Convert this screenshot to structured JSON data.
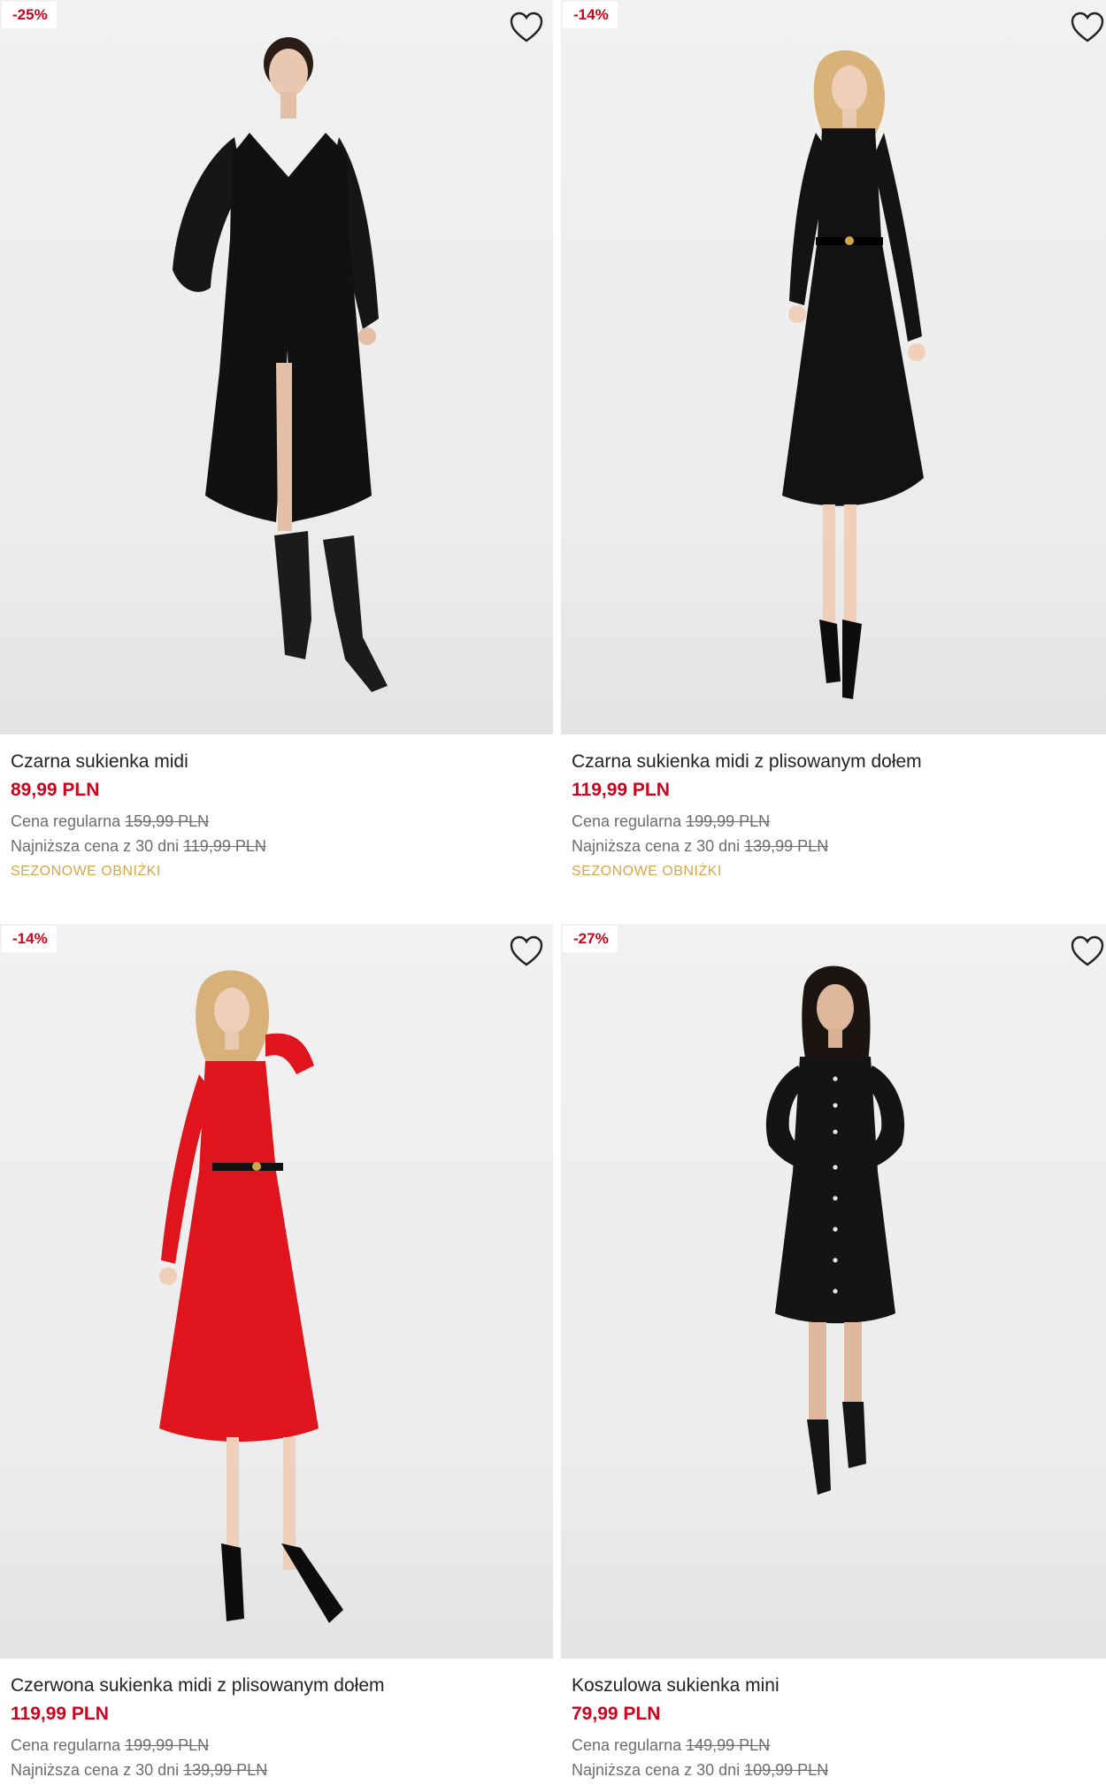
{
  "colors": {
    "accent_red": "#d0021b",
    "season_tag": "#d4a849",
    "muted": "#6d6d6d"
  },
  "products": [
    {
      "discount": "-25%",
      "name": "Czarna sukienka midi",
      "price": "89,99 PLN",
      "regular_label": "Cena regularna",
      "regular_price": "159,99 PLN",
      "lowest_label": "Najniższa cena z 30 dni",
      "lowest_price": "119,99 PLN",
      "tag": "SEZONOWE OBNIŻKI",
      "favorite_icon": "heart-icon",
      "dress_color": "#111111"
    },
    {
      "discount": "-14%",
      "name": "Czarna sukienka midi z plisowanym dołem",
      "price": "119,99 PLN",
      "regular_label": "Cena regularna",
      "regular_price": "199,99 PLN",
      "lowest_label": "Najniższa cena z 30 dni",
      "lowest_price": "139,99 PLN",
      "tag": "SEZONOWE OBNIŻKI",
      "favorite_icon": "heart-icon",
      "dress_color": "#121212"
    },
    {
      "discount": "-14%",
      "name": "Czerwona sukienka midi z plisowanym dołem",
      "price": "119,99 PLN",
      "regular_label": "Cena regularna",
      "regular_price": "199,99 PLN",
      "lowest_label": "Najniższa cena z 30 dni",
      "lowest_price": "139,99 PLN",
      "favorite_icon": "heart-icon",
      "dress_color": "#e0141d"
    },
    {
      "discount": "-27%",
      "name": "Koszulowa sukienka mini",
      "price": "79,99 PLN",
      "regular_label": "Cena regularna",
      "regular_price": "149,99 PLN",
      "lowest_label": "Najniższa cena z 30 dni",
      "lowest_price": "109,99 PLN",
      "favorite_icon": "heart-icon",
      "dress_color": "#141414"
    }
  ]
}
